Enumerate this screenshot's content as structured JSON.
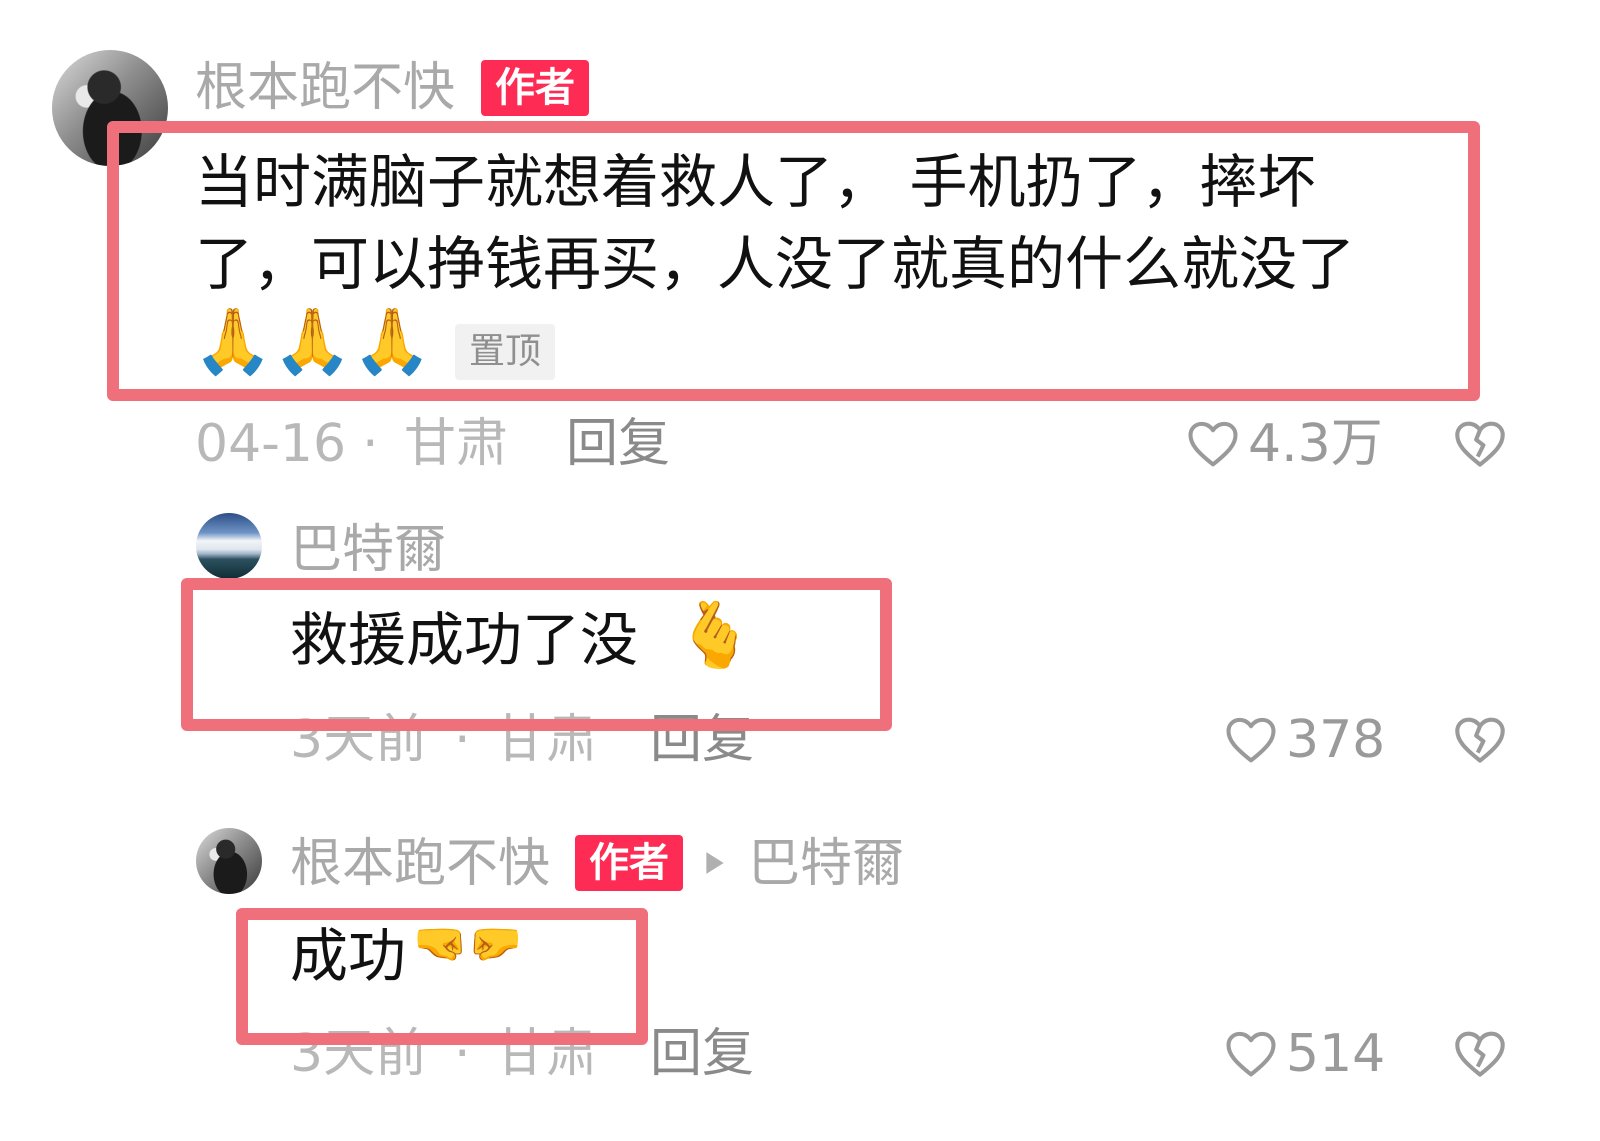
{
  "comments": [
    {
      "author": "根本跑不快",
      "badge": "作者",
      "avatar_icon": "avatar-dark-photo",
      "text_line1": "当时满脑子就想着救人了， 手机扔了，摔坏",
      "text_line2": "了，可以挣钱再买，人没了就真的什么就没了",
      "emoji": "🙏🙏🙏",
      "pin_label": "置顶",
      "date": "04-16",
      "location": "甘肃",
      "meta_sep": "·",
      "reply_label": "回复",
      "likes": "4.3万"
    },
    {
      "author": "巴特爾",
      "avatar_icon": "avatar-sky-photo",
      "text": "救援成功了没",
      "emoji": "🫰",
      "date": "3天前",
      "location": "甘肃",
      "meta_sep": "·",
      "reply_label": "回复",
      "likes": "378"
    },
    {
      "author": "根本跑不快",
      "badge": "作者",
      "reply_to": "巴特爾",
      "avatar_icon": "avatar-dark-photo",
      "text": "成功",
      "emoji": "🤜🤛",
      "date": "3天前",
      "location": "甘肃",
      "meta_sep": "·",
      "reply_label": "回复",
      "likes": "514"
    }
  ],
  "colors": {
    "author_badge": "#fe2c55",
    "highlight_box": "#ef6f7a",
    "name_gray": "#a9a9a9"
  }
}
